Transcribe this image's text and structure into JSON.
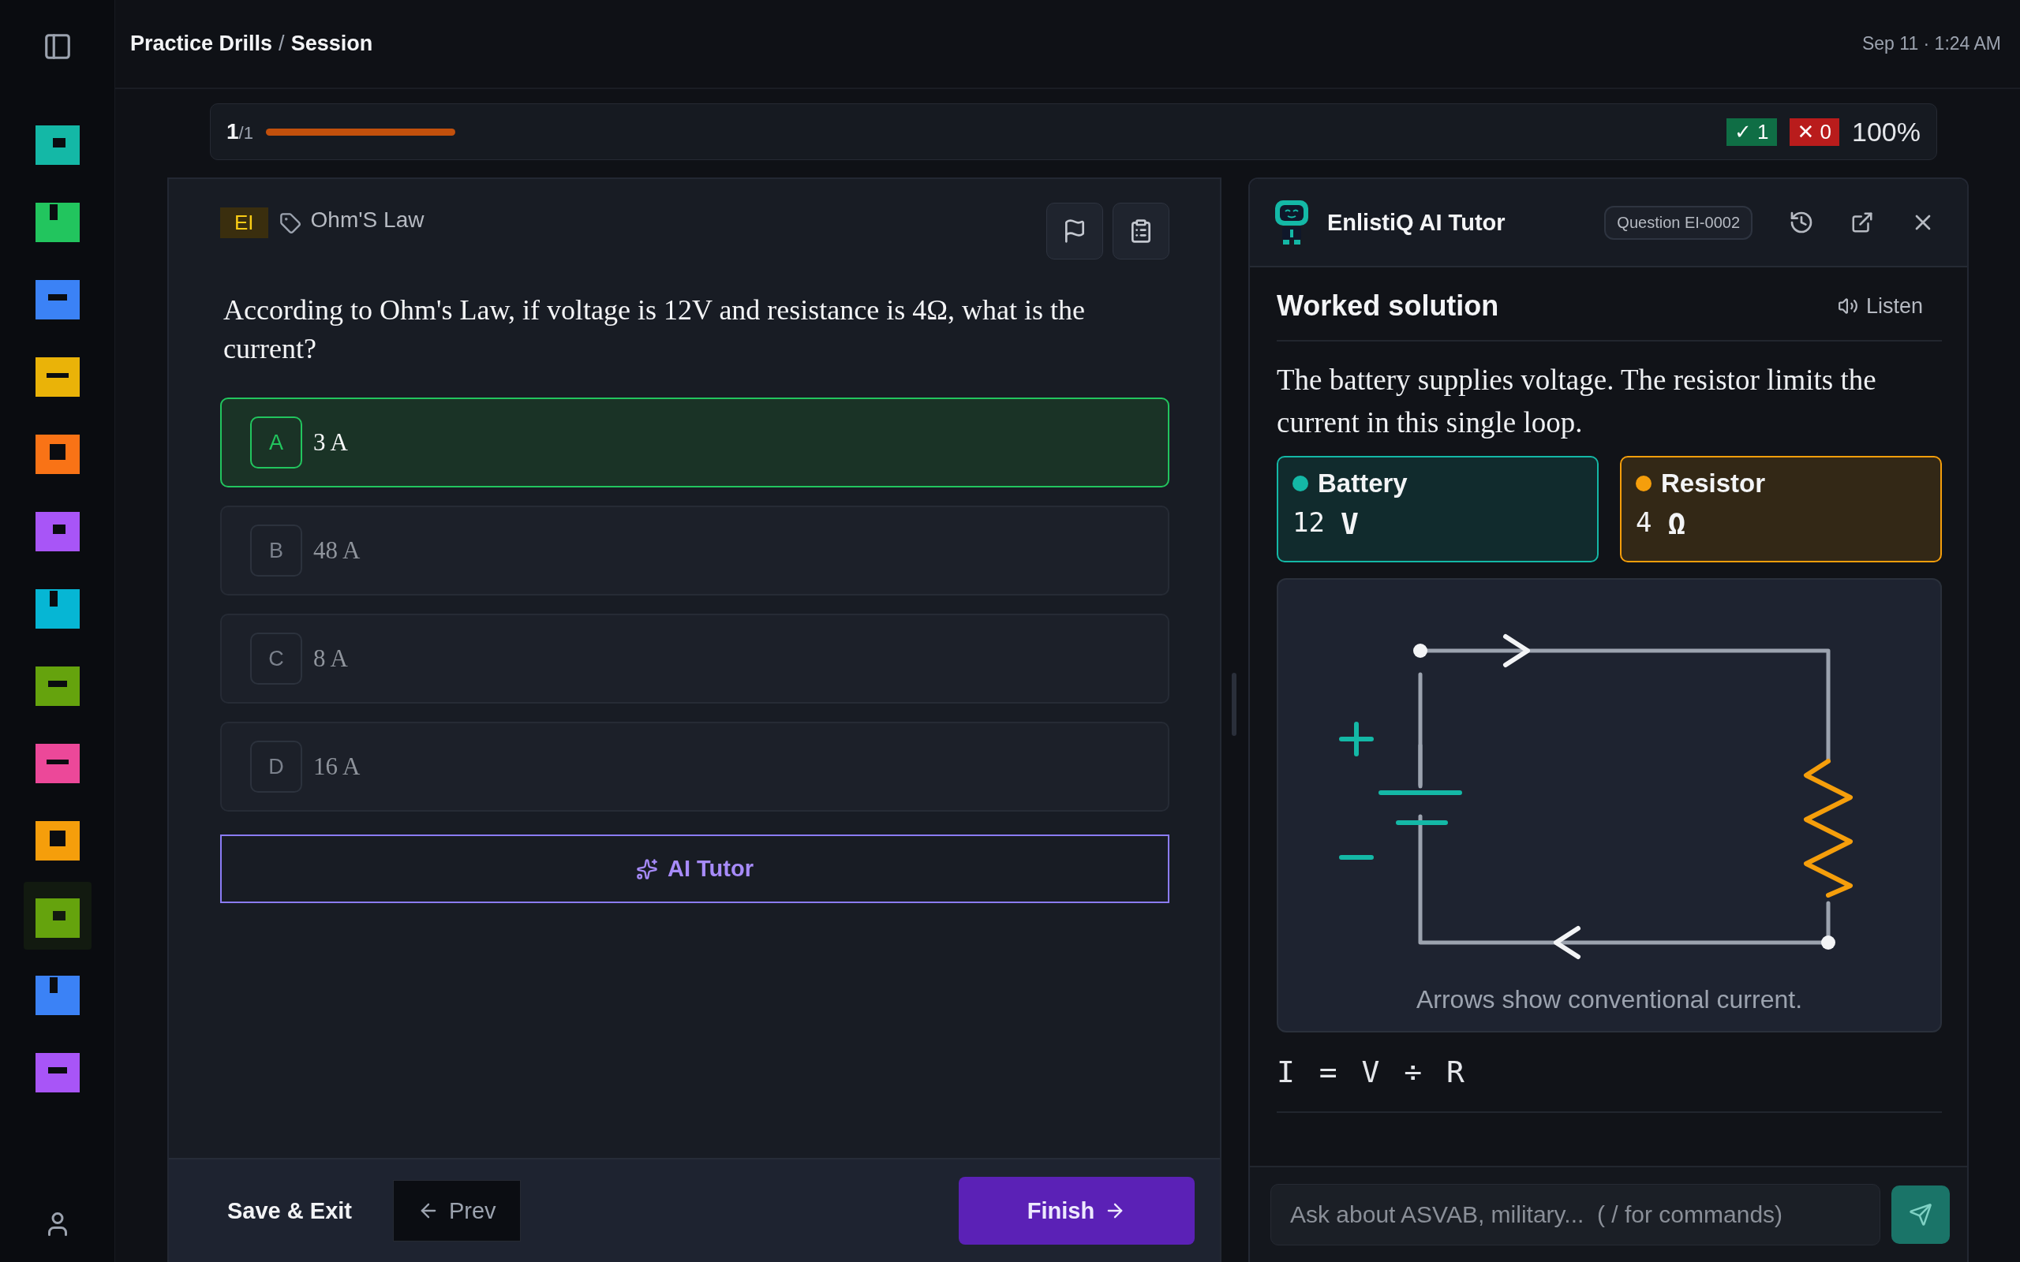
{
  "sidebar": {
    "items": [
      {
        "color": "#14b8a6",
        "selected": false
      },
      {
        "color": "#22c55e",
        "selected": false
      },
      {
        "color": "#3b82f6",
        "selected": false
      },
      {
        "color": "#eab308",
        "selected": false
      },
      {
        "color": "#f97316",
        "selected": false
      },
      {
        "color": "#a855f7",
        "selected": false
      },
      {
        "color": "#06b6d4",
        "selected": false
      },
      {
        "color": "#65a30d",
        "selected": false
      },
      {
        "color": "#ec4899",
        "selected": false
      },
      {
        "color": "#f59e0b",
        "selected": false
      },
      {
        "color": "#65a30d",
        "selected": true
      },
      {
        "color": "#3b82f6",
        "selected": false
      },
      {
        "color": "#a855f7",
        "selected": false
      }
    ]
  },
  "header": {
    "parent": "Practice Drills",
    "separator": "/",
    "current": "Session",
    "datetime": "Sep 11 · 1:24 AM"
  },
  "progress": {
    "current": "1",
    "total": "/1",
    "level": 1,
    "correct": "✓ 1",
    "wrong": "✕ 0",
    "score": "100%"
  },
  "question": {
    "category": "EI",
    "tag": "Ohm'S Law",
    "text": "According to Ohm's Law, if voltage is 12V and resistance is 4Ω, what is the current?",
    "options": [
      {
        "letter": "A",
        "text": "3 A",
        "selected": true
      },
      {
        "letter": "B",
        "text": "48 A",
        "selected": false
      },
      {
        "letter": "C",
        "text": "8 A",
        "selected": false
      },
      {
        "letter": "D",
        "text": "16 A",
        "selected": false
      }
    ],
    "tutor_button": "AI Tutor"
  },
  "footer": {
    "save": "Save & Exit",
    "prev": "Prev",
    "finish": "Finish"
  },
  "tutor": {
    "title": "EnlistiQ AI Tutor",
    "question_id": "Question EI-0002",
    "heading": "Worked solution",
    "listen": "Listen",
    "explanation": "The battery supplies voltage. The resistor limits the current in this single loop.",
    "components": [
      {
        "name": "Battery",
        "value": "12",
        "unit": "V",
        "color": "#14b8a6"
      },
      {
        "name": "Resistor",
        "value": "4",
        "unit": "Ω",
        "color": "#f59e0b"
      }
    ],
    "caption": "Arrows show conventional current.",
    "formula": "I = V ÷ R",
    "input": {
      "placeholder": "Ask about ASVAB, military...  ( / for commands)"
    }
  }
}
